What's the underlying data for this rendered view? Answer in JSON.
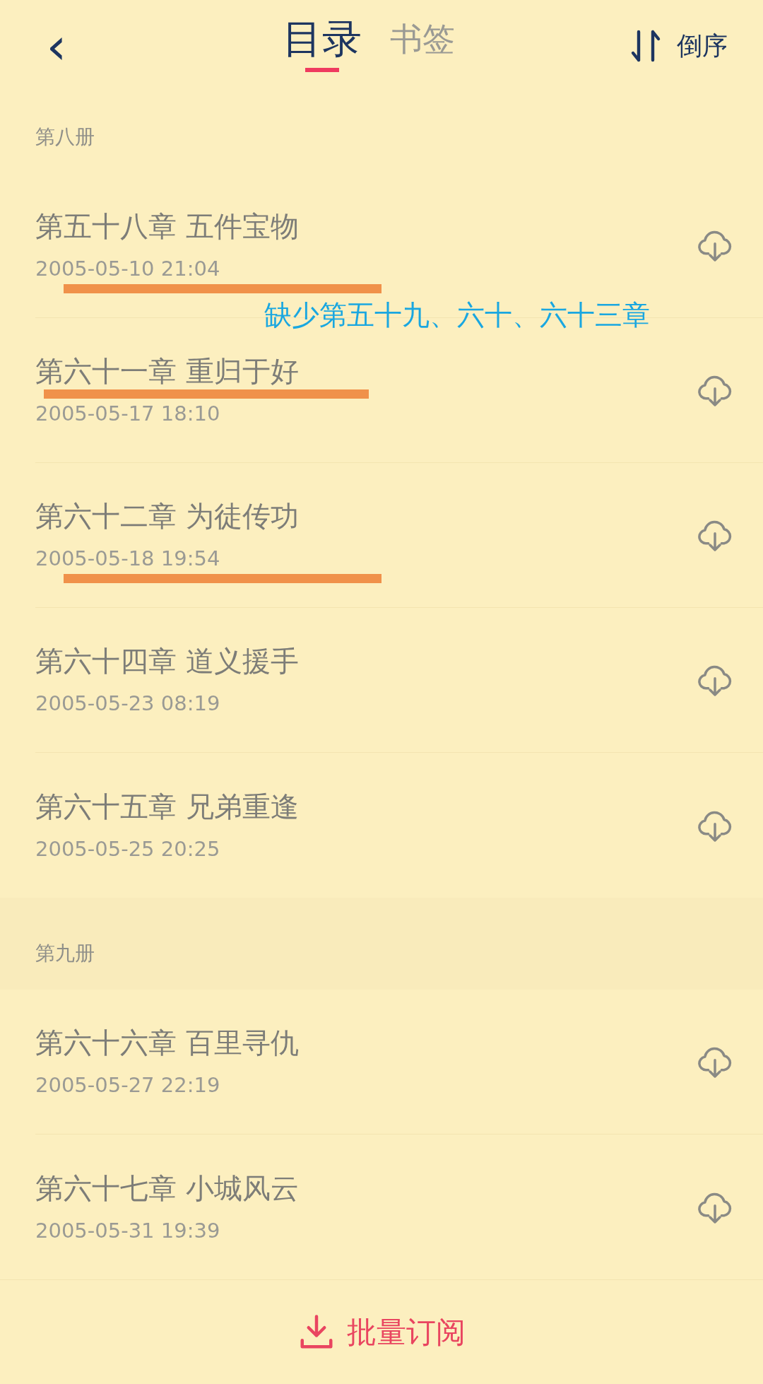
{
  "header": {
    "back": "‹",
    "tabs": [
      {
        "label": "目录",
        "selected": true
      },
      {
        "label": "书签",
        "selected": false
      }
    ],
    "sort": "倒序"
  },
  "annotation": "缺少第五十九、六十、六十三章",
  "volumes": [
    {
      "title": "第八册",
      "chapters": [
        {
          "title": "第五十八章 五件宝物",
          "date": "2005-05-10 21:04",
          "title_underlined": false,
          "date_underlined": true
        },
        {
          "title": "第六十一章 重归于好",
          "date": "2005-05-17 18:10",
          "title_underlined": true,
          "date_underlined": false
        },
        {
          "title": "第六十二章 为徒传功",
          "date": "2005-05-18 19:54",
          "title_underlined": false,
          "date_underlined": true
        },
        {
          "title": "第六十四章 道义援手",
          "date": "2005-05-23 08:19",
          "title_underlined": false,
          "date_underlined": false
        },
        {
          "title": "第六十五章 兄弟重逢",
          "date": "2005-05-25 20:25",
          "title_underlined": false,
          "date_underlined": false
        }
      ]
    },
    {
      "title": "第九册",
      "chapters": [
        {
          "title": "第六十六章 百里寻仇",
          "date": "2005-05-27 22:19",
          "title_underlined": false,
          "date_underlined": false
        },
        {
          "title": "第六十七章 小城风云",
          "date": "2005-05-31 19:39",
          "title_underlined": false,
          "date_underlined": false
        }
      ]
    }
  ],
  "bottom_button": "批量订阅"
}
